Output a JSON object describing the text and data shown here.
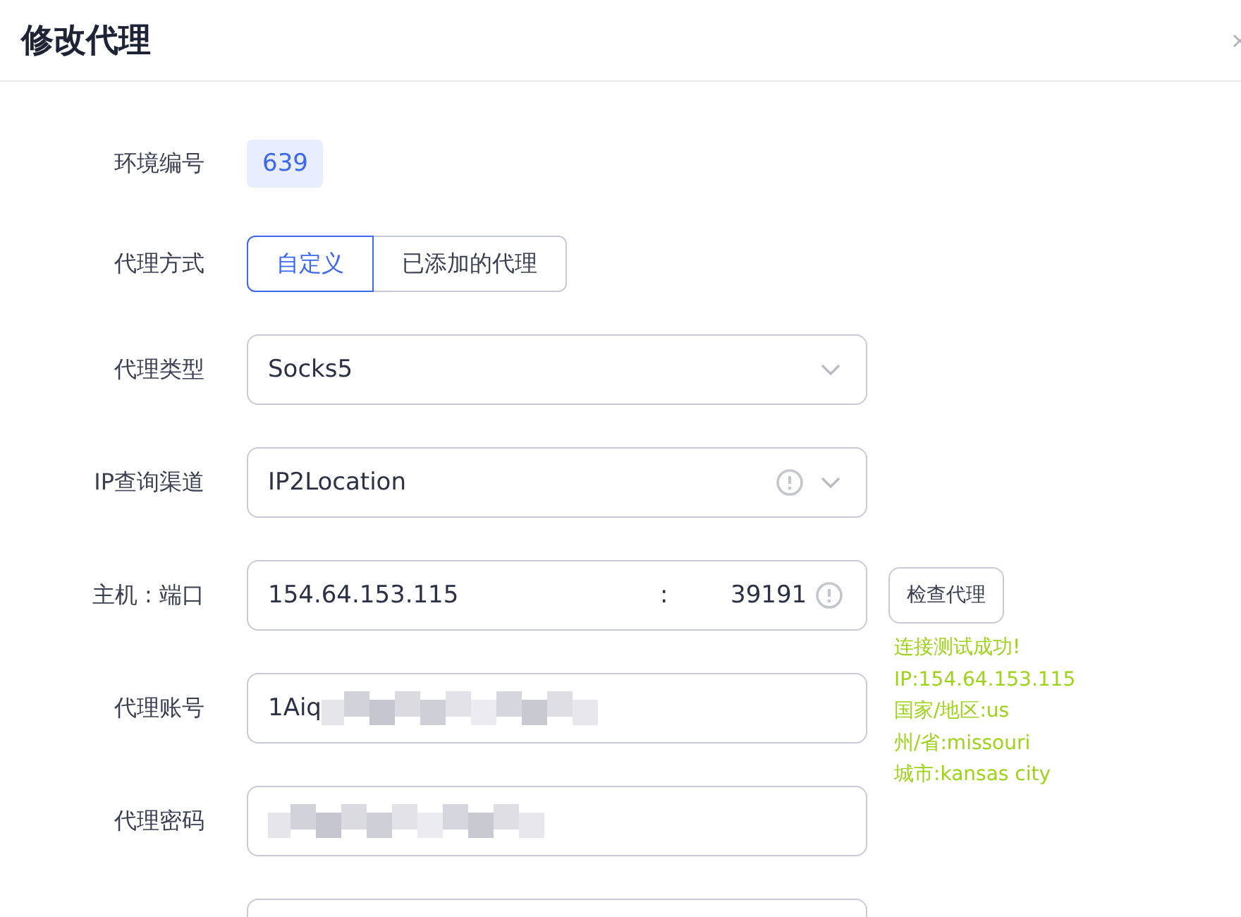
{
  "dialog": {
    "title": "修改代理"
  },
  "fields": [
    {
      "kind": "badge",
      "label": "环境编号",
      "value": "639"
    },
    {
      "kind": "segmented",
      "label": "代理方式",
      "options": [
        {
          "label": "自定义",
          "selected": true
        },
        {
          "label": "已添加的代理",
          "selected": false
        }
      ]
    },
    {
      "kind": "select",
      "label": "代理类型",
      "value": "Socks5"
    },
    {
      "kind": "select",
      "label": "IP查询渠道",
      "value": "IP2Location",
      "info": true
    },
    {
      "kind": "hostport",
      "label": "主机 : 端口",
      "host": "154.64.153.115",
      "separator": ":",
      "port": "39191",
      "button": "检查代理",
      "result": [
        "连接测试成功!",
        "IP:154.64.153.115",
        "国家/地区:us",
        "州/省:missouri",
        "城市:kansas city"
      ]
    },
    {
      "kind": "masked",
      "label": "代理账号",
      "value": "1Aiq"
    },
    {
      "kind": "masked",
      "label": "代理密码"
    },
    {
      "kind": "text"
    }
  ]
}
